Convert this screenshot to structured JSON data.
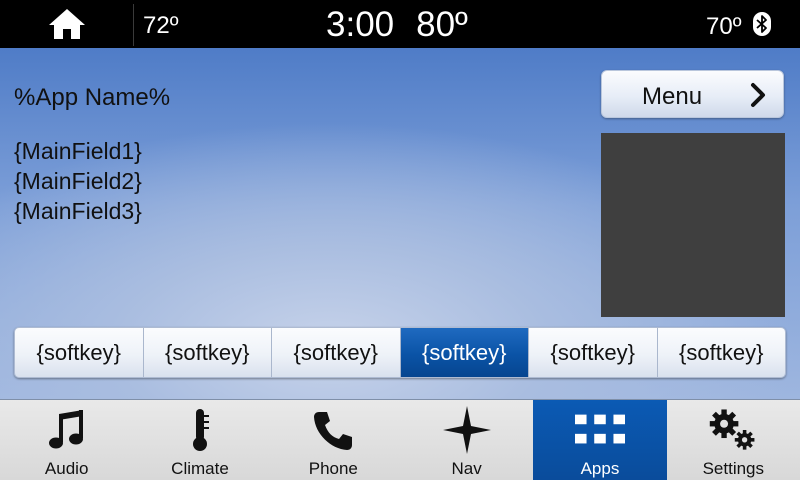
{
  "status": {
    "temp_left": "72º",
    "time": "3:00",
    "temp_center": "80º",
    "temp_right": "70º"
  },
  "main": {
    "app_name": "%App Name%",
    "fields": [
      "{MainField1}",
      "{MainField2}",
      "{MainField3}"
    ],
    "menu_label": "Menu"
  },
  "softkeys": [
    "{softkey}",
    "{softkey}",
    "{softkey}",
    "{softkey}",
    "{softkey}",
    "{softkey}"
  ],
  "softkey_selected_index": 3,
  "nav": {
    "items": [
      {
        "label": "Audio",
        "icon": "music-note-icon"
      },
      {
        "label": "Climate",
        "icon": "thermometer-icon"
      },
      {
        "label": "Phone",
        "icon": "phone-icon"
      },
      {
        "label": "Nav",
        "icon": "compass-star-icon"
      },
      {
        "label": "Apps",
        "icon": "apps-grid-icon"
      },
      {
        "label": "Settings",
        "icon": "gears-icon"
      }
    ],
    "active_index": 4
  },
  "colors": {
    "accent": "#0a53a6",
    "graphic_placeholder": "#3f3f3f"
  }
}
